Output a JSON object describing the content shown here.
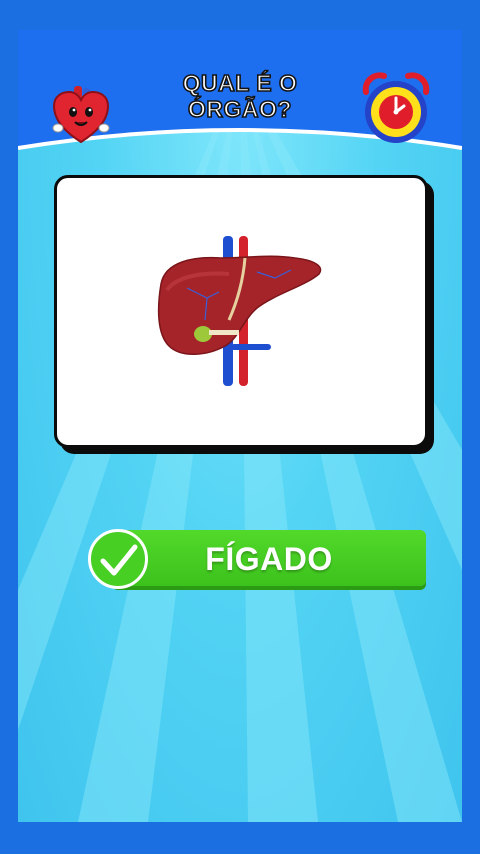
{
  "header": {
    "title_line1": "QUAL É O",
    "title_line2": "ÓRGÃO?",
    "left_icon": "heart-mascot-icon",
    "right_icon": "alarm-clock-icon"
  },
  "question": {
    "image": "liver-illustration"
  },
  "answer": {
    "label": "FÍGADO",
    "status_icon": "checkmark-icon"
  },
  "colors": {
    "outer_bg": "#1b6fe0",
    "sky": "#53d4f4",
    "header_blue": "#1e6ff0",
    "answer_green": "#47cf24",
    "clock_yellow": "#ffe01a",
    "clock_red": "#e01d2a"
  }
}
